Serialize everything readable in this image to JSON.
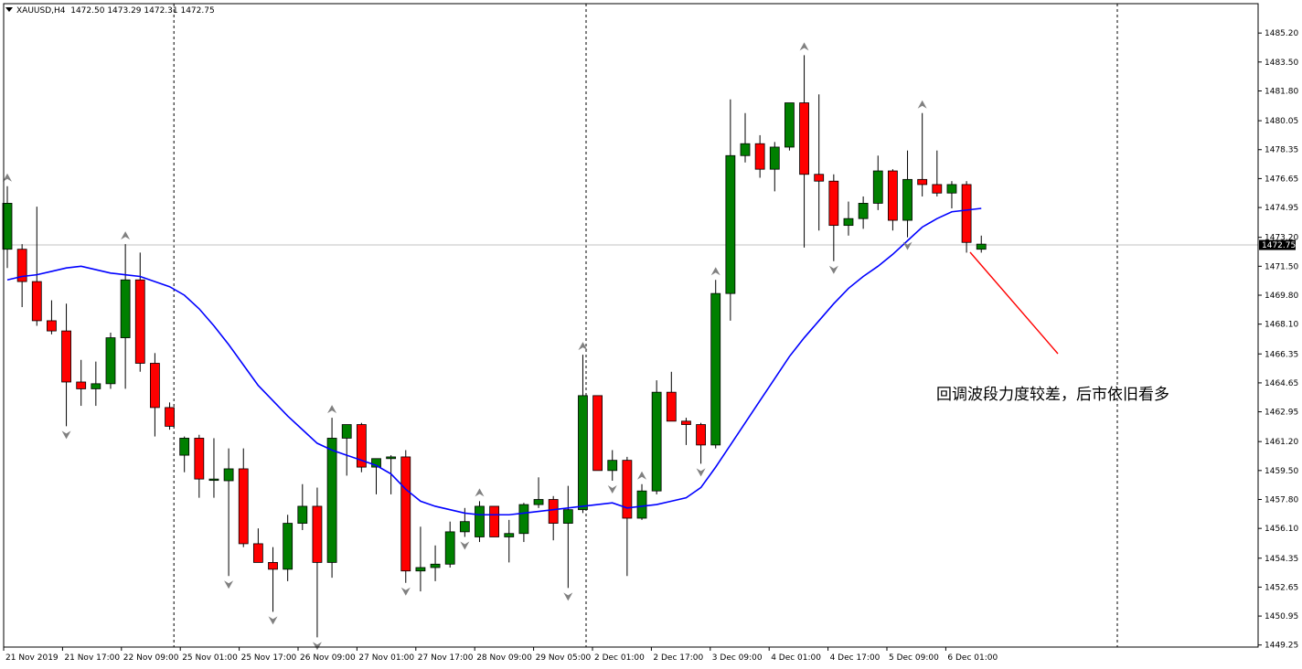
{
  "header": {
    "symbol": "XAUUSD,H4",
    "ohlc": "1472.50 1473.29 1472.31 1472.75"
  },
  "annotation": {
    "text": "回调波段力度较差，后市依旧看多"
  },
  "colors": {
    "bull": "#008000",
    "bear": "#ff0000",
    "ma": "#0000ff",
    "arrow_line": "#ff0000",
    "fractal": "#808080",
    "current_price_box": "#000000"
  },
  "chart_data": {
    "type": "candlestick",
    "ylim": [
      1449.29,
      1486.39
    ],
    "y_ticks": [
      "1485.20",
      "1483.50",
      "1481.80",
      "1480.05",
      "1478.35",
      "1476.65",
      "1474.95",
      "1473.20",
      "1471.50",
      "1469.80",
      "1468.10",
      "1466.35",
      "1464.65",
      "1462.95",
      "1461.20",
      "1459.50",
      "1457.80",
      "1456.10",
      "1454.35",
      "1452.65",
      "1450.95",
      "1449.25"
    ],
    "x_labels": [
      "21 Nov 2019",
      "21 Nov 17:00",
      "22 Nov 09:00",
      "25 Nov 01:00",
      "25 Nov 17:00",
      "26 Nov 09:00",
      "27 Nov 01:00",
      "27 Nov 17:00",
      "28 Nov 09:00",
      "29 Nov 05:00",
      "2 Dec 01:00",
      "2 Dec 17:00",
      "3 Dec 09:00",
      "4 Dec 01:00",
      "4 Dec 17:00",
      "5 Dec 09:00",
      "6 Dec 01:00"
    ],
    "day_separators_after_label": [
      "25 Nov 01:00",
      "2 Dec 01:00"
    ],
    "current_price": "1472.75",
    "candles": [
      {
        "o": 1472.5,
        "h": 1476.2,
        "l": 1471.4,
        "c": 1475.2
      },
      {
        "o": 1472.5,
        "h": 1472.8,
        "l": 1469.1,
        "c": 1470.6
      },
      {
        "o": 1470.6,
        "h": 1475.0,
        "l": 1468.0,
        "c": 1468.3
      },
      {
        "o": 1468.3,
        "h": 1469.5,
        "l": 1467.5,
        "c": 1467.7
      },
      {
        "o": 1467.7,
        "h": 1469.3,
        "l": 1462.1,
        "c": 1464.7
      },
      {
        "o": 1464.7,
        "h": 1466.0,
        "l": 1463.3,
        "c": 1464.3
      },
      {
        "o": 1464.3,
        "h": 1465.9,
        "l": 1463.3,
        "c": 1464.6
      },
      {
        "o": 1464.6,
        "h": 1467.6,
        "l": 1464.3,
        "c": 1467.3
      },
      {
        "o": 1467.3,
        "h": 1472.8,
        "l": 1464.3,
        "c": 1470.7
      },
      {
        "o": 1470.7,
        "h": 1472.3,
        "l": 1465.3,
        "c": 1465.8
      },
      {
        "o": 1465.8,
        "h": 1466.4,
        "l": 1461.5,
        "c": 1463.2
      },
      {
        "o": 1463.2,
        "h": 1463.5,
        "l": 1461.9,
        "c": 1462.1
      },
      {
        "o": 1460.4,
        "h": 1461.5,
        "l": 1459.4,
        "c": 1461.4
      },
      {
        "o": 1461.4,
        "h": 1461.6,
        "l": 1457.9,
        "c": 1459.0
      },
      {
        "o": 1459.0,
        "h": 1461.4,
        "l": 1457.9,
        "c": 1459.0
      },
      {
        "o": 1458.9,
        "h": 1460.8,
        "l": 1453.3,
        "c": 1459.6
      },
      {
        "o": 1459.6,
        "h": 1460.8,
        "l": 1455.0,
        "c": 1455.2
      },
      {
        "o": 1455.2,
        "h": 1456.1,
        "l": 1454.1,
        "c": 1454.1
      },
      {
        "o": 1454.1,
        "h": 1455.0,
        "l": 1451.2,
        "c": 1453.7
      },
      {
        "o": 1453.7,
        "h": 1456.9,
        "l": 1453.0,
        "c": 1456.4
      },
      {
        "o": 1456.4,
        "h": 1458.7,
        "l": 1456.0,
        "c": 1457.4
      },
      {
        "o": 1457.4,
        "h": 1458.5,
        "l": 1449.7,
        "c": 1454.1
      },
      {
        "o": 1454.1,
        "h": 1462.6,
        "l": 1453.2,
        "c": 1461.4
      },
      {
        "o": 1461.4,
        "h": 1462.1,
        "l": 1459.2,
        "c": 1462.2
      },
      {
        "o": 1462.2,
        "h": 1462.3,
        "l": 1459.4,
        "c": 1459.7
      },
      {
        "o": 1459.7,
        "h": 1460.1,
        "l": 1458.1,
        "c": 1460.2
      },
      {
        "o": 1460.2,
        "h": 1460.4,
        "l": 1458.1,
        "c": 1460.3
      },
      {
        "o": 1460.3,
        "h": 1460.7,
        "l": 1452.9,
        "c": 1453.6
      },
      {
        "o": 1453.6,
        "h": 1456.2,
        "l": 1452.4,
        "c": 1453.8
      },
      {
        "o": 1453.8,
        "h": 1455.1,
        "l": 1453.0,
        "c": 1454.0
      },
      {
        "o": 1454.0,
        "h": 1456.5,
        "l": 1453.8,
        "c": 1455.9
      },
      {
        "o": 1455.9,
        "h": 1457.3,
        "l": 1455.6,
        "c": 1456.5
      },
      {
        "o": 1455.6,
        "h": 1457.7,
        "l": 1455.3,
        "c": 1457.4
      },
      {
        "o": 1457.4,
        "h": 1457.4,
        "l": 1455.6,
        "c": 1455.6
      },
      {
        "o": 1455.6,
        "h": 1456.6,
        "l": 1454.1,
        "c": 1455.8
      },
      {
        "o": 1455.8,
        "h": 1457.6,
        "l": 1455.3,
        "c": 1457.5
      },
      {
        "o": 1457.5,
        "h": 1459.1,
        "l": 1457.3,
        "c": 1457.8
      },
      {
        "o": 1457.8,
        "h": 1458.0,
        "l": 1455.4,
        "c": 1456.4
      },
      {
        "o": 1456.4,
        "h": 1458.6,
        "l": 1452.6,
        "c": 1457.2
      },
      {
        "o": 1457.2,
        "h": 1466.3,
        "l": 1457.0,
        "c": 1463.9
      },
      {
        "o": 1463.9,
        "h": 1463.8,
        "l": 1459.5,
        "c": 1459.5
      },
      {
        "o": 1459.5,
        "h": 1460.7,
        "l": 1458.9,
        "c": 1460.1
      },
      {
        "o": 1460.1,
        "h": 1460.3,
        "l": 1453.3,
        "c": 1456.7
      },
      {
        "o": 1456.7,
        "h": 1458.7,
        "l": 1456.6,
        "c": 1458.3
      },
      {
        "o": 1458.3,
        "h": 1464.8,
        "l": 1458.1,
        "c": 1464.1
      },
      {
        "o": 1464.1,
        "h": 1465.3,
        "l": 1462.4,
        "c": 1462.4
      },
      {
        "o": 1462.4,
        "h": 1462.6,
        "l": 1461.0,
        "c": 1462.2
      },
      {
        "o": 1462.2,
        "h": 1462.3,
        "l": 1459.9,
        "c": 1461.0
      },
      {
        "o": 1461.0,
        "h": 1470.7,
        "l": 1460.8,
        "c": 1469.9
      },
      {
        "o": 1469.9,
        "h": 1481.3,
        "l": 1468.3,
        "c": 1478.0
      },
      {
        "o": 1478.0,
        "h": 1480.5,
        "l": 1477.6,
        "c": 1478.7
      },
      {
        "o": 1478.7,
        "h": 1479.2,
        "l": 1476.7,
        "c": 1477.2
      },
      {
        "o": 1477.2,
        "h": 1478.8,
        "l": 1475.9,
        "c": 1478.5
      },
      {
        "o": 1478.5,
        "h": 1481.1,
        "l": 1478.3,
        "c": 1481.1
      },
      {
        "o": 1481.1,
        "h": 1483.9,
        "l": 1472.6,
        "c": 1476.9
      },
      {
        "o": 1476.9,
        "h": 1481.6,
        "l": 1473.6,
        "c": 1476.5
      },
      {
        "o": 1476.5,
        "h": 1476.9,
        "l": 1471.8,
        "c": 1473.9
      },
      {
        "o": 1473.9,
        "h": 1475.3,
        "l": 1473.3,
        "c": 1474.3
      },
      {
        "o": 1474.3,
        "h": 1475.6,
        "l": 1473.7,
        "c": 1475.2
      },
      {
        "o": 1475.2,
        "h": 1478.0,
        "l": 1474.8,
        "c": 1477.1
      },
      {
        "o": 1477.1,
        "h": 1477.2,
        "l": 1473.6,
        "c": 1474.2
      },
      {
        "o": 1474.2,
        "h": 1478.3,
        "l": 1473.2,
        "c": 1476.6
      },
      {
        "o": 1476.6,
        "h": 1480.5,
        "l": 1475.6,
        "c": 1476.3
      },
      {
        "o": 1476.3,
        "h": 1478.3,
        "l": 1475.6,
        "c": 1475.8
      },
      {
        "o": 1475.8,
        "h": 1476.5,
        "l": 1474.9,
        "c": 1476.3
      },
      {
        "o": 1476.3,
        "h": 1476.5,
        "l": 1472.3,
        "c": 1472.9
      },
      {
        "o": 1472.5,
        "h": 1473.3,
        "l": 1472.3,
        "c": 1472.8
      }
    ],
    "moving_average": [
      1470.7,
      1470.9,
      1471.0,
      1471.2,
      1471.4,
      1471.5,
      1471.3,
      1471.1,
      1471.0,
      1470.9,
      1470.6,
      1470.3,
      1469.8,
      1469.0,
      1468.0,
      1466.9,
      1465.7,
      1464.5,
      1463.6,
      1462.7,
      1461.9,
      1461.1,
      1460.7,
      1460.4,
      1460.1,
      1459.8,
      1459.3,
      1458.4,
      1457.7,
      1457.4,
      1457.2,
      1457.0,
      1456.9,
      1456.9,
      1456.9,
      1457.0,
      1457.1,
      1457.2,
      1457.3,
      1457.4,
      1457.5,
      1457.6,
      1457.3,
      1457.4,
      1457.5,
      1457.7,
      1457.9,
      1458.5,
      1459.7,
      1461.0,
      1462.3,
      1463.6,
      1464.9,
      1466.2,
      1467.3,
      1468.3,
      1469.3,
      1470.2,
      1470.9,
      1471.5,
      1472.2,
      1473.0,
      1473.8,
      1474.3,
      1474.7,
      1474.8,
      1474.9
    ],
    "fractals_up": [
      0,
      8,
      22,
      32,
      39,
      43,
      48,
      54,
      62
    ],
    "fractals_down": [
      4,
      15,
      18,
      21,
      27,
      31,
      38,
      41,
      47,
      56,
      61
    ]
  }
}
